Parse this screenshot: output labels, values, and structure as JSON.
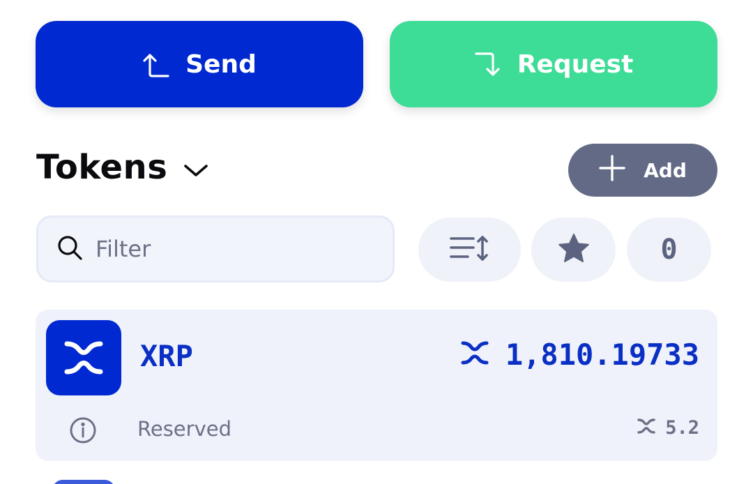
{
  "actions": {
    "send_label": "Send",
    "request_label": "Request"
  },
  "tokens_header": {
    "title": "Tokens",
    "add_label": "Add"
  },
  "filter": {
    "placeholder": "Filter"
  },
  "toolbar": {
    "count_label": "0"
  },
  "token_list": [
    {
      "name": "XRP",
      "balance": "1,810.19733",
      "reserved_label": "Reserved",
      "reserved_value": "5.2"
    }
  ],
  "colors": {
    "send": "#0029d1",
    "request": "#3ddc97",
    "add": "#626a85",
    "token_text": "#0a2fc4",
    "card_bg": "#eff2fb"
  },
  "icons": {
    "send": "arrow-up-left-icon",
    "request": "arrow-down-right-icon",
    "dropdown": "chevron-down-icon",
    "add": "plus-icon",
    "search": "search-icon",
    "sort": "sort-icon",
    "favorite": "star-icon",
    "token": "xrp-logo-icon",
    "info": "info-icon"
  }
}
